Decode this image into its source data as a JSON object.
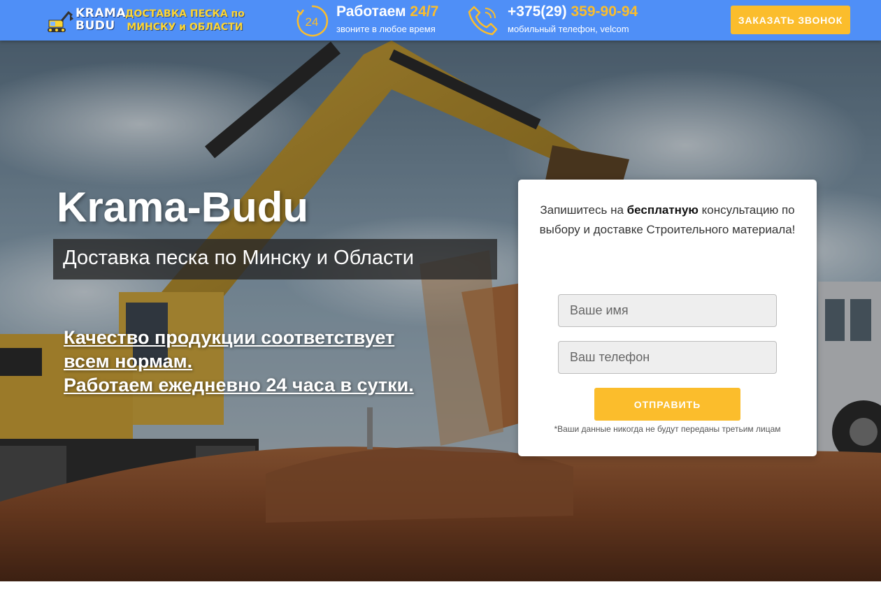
{
  "header": {
    "logo": {
      "brand_line1": "KRAMA",
      "brand_line2": "BUDU",
      "separator": "-",
      "slogan_line1": "ДОСТАВКА ПЕСКА по",
      "slogan_line2": "МИНСКУ и ОБЛАСТИ"
    },
    "hours": {
      "icon": "clock-24-icon",
      "icon_text": "24",
      "title_main": "Работаем ",
      "title_accent": "24/7",
      "subtitle": "звоните в любое время"
    },
    "phone": {
      "icon": "phone-icon",
      "number_main": "+375(29) ",
      "number_accent": "359-90-94",
      "subtitle": "мобильный телефон, velcom"
    },
    "call_button_label": "ЗАКАЗАТЬ ЗВОНОК"
  },
  "hero": {
    "title": "Krama-Budu",
    "subtitle": "Доставка песка по Минску и Области",
    "features": [
      "Качество продукции соответствует",
      "всем нормам.",
      "Работаем ежедневно 24 часа в сутки."
    ]
  },
  "form": {
    "text_before": "Запишитесь на ",
    "text_bold": "бесплатную",
    "text_after": " консультацию по выбору и доставке Строительного материала!",
    "name_placeholder": "Ваше имя",
    "phone_placeholder": "Ваш телефон",
    "submit_label": "ОТПРАВИТЬ",
    "privacy_note": "*Ваши данные никогда не будут переданы третьим лицам"
  },
  "colors": {
    "header_bg": "#4f8ff7",
    "accent": "#fbbd2c",
    "slogan": "#fcd533"
  }
}
